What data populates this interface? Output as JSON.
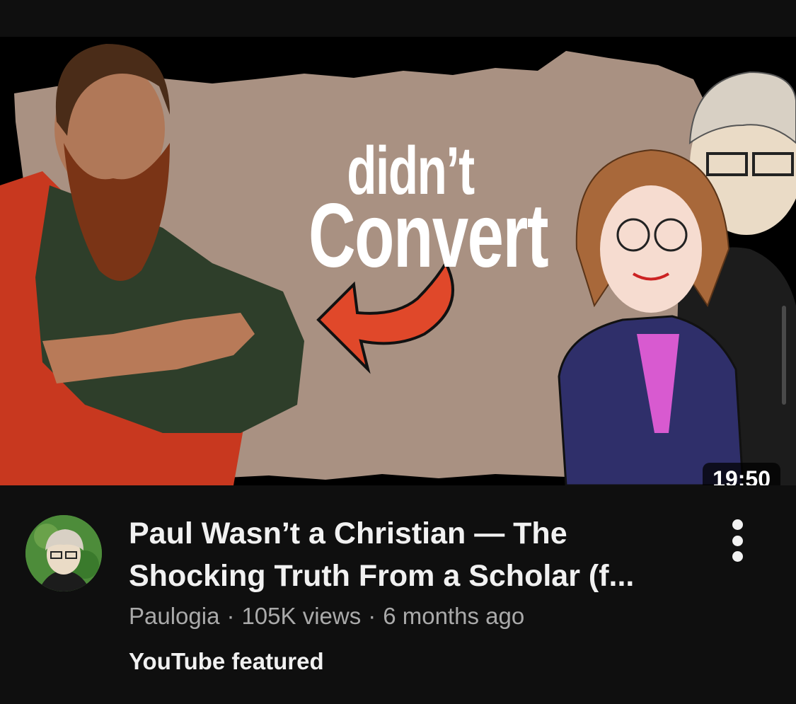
{
  "thumbnail": {
    "line1": "didn’t",
    "line2": "Convert",
    "duration": "19:50"
  },
  "video": {
    "title": "Paul Wasn’t a Christian — The Shocking Truth From a Scholar (f...",
    "channel": "Paulogia",
    "separator": "·",
    "views": "105K views",
    "age": "6 months ago",
    "badge": "YouTube featured"
  },
  "icons": {
    "more": "more-vertical-icon",
    "arrow": "curved-arrow-icon"
  },
  "colors": {
    "background": "#0f0f0f",
    "thumb_backdrop": "#a89080",
    "arrow": "#e0482a",
    "meta_text": "#aaaaaa"
  }
}
